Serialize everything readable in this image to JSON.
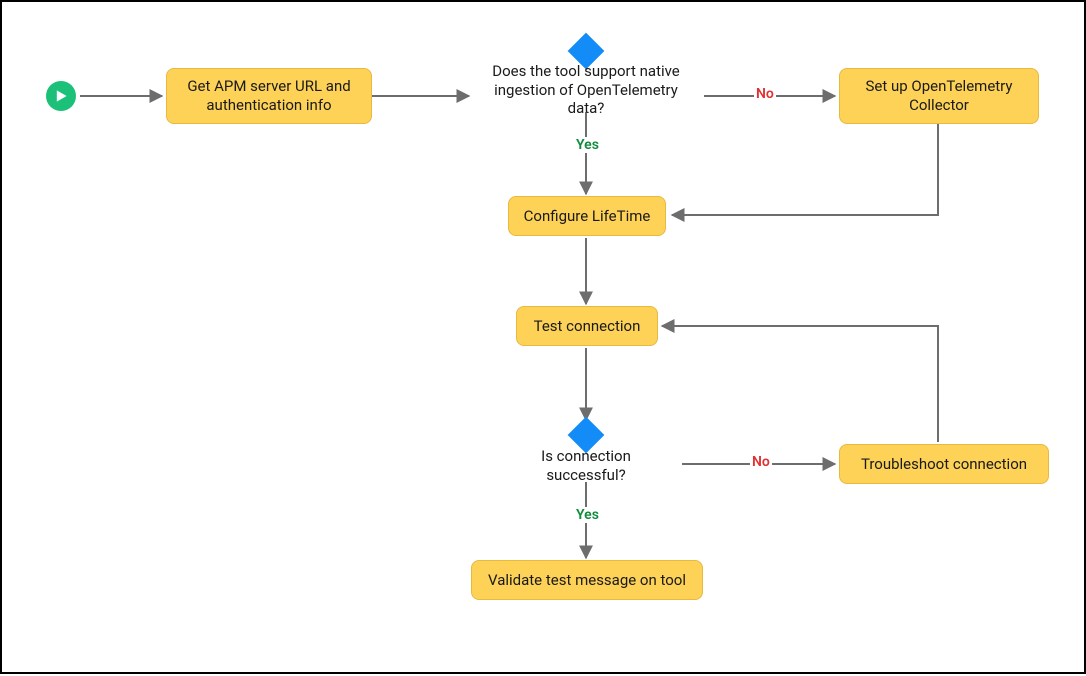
{
  "nodes": {
    "start": {
      "type": "start"
    },
    "get_apm": {
      "type": "process",
      "label": "Get APM server URL and authentication info"
    },
    "decision_native": {
      "type": "decision",
      "label": "Does the tool support native ingestion of OpenTelemetry data?"
    },
    "set_up_collector": {
      "type": "process",
      "label": "Set up OpenTelemetry Collector"
    },
    "configure_lifetime": {
      "type": "process",
      "label": "Configure LifeTime"
    },
    "test_connection": {
      "type": "process",
      "label": "Test connection"
    },
    "decision_success": {
      "type": "decision",
      "label": "Is connection successful?"
    },
    "troubleshoot": {
      "type": "process",
      "label": "Troubleshoot  connection"
    },
    "validate": {
      "type": "process",
      "label": "Validate test message on tool"
    }
  },
  "edges": [
    {
      "from": "start",
      "to": "get_apm",
      "label": null
    },
    {
      "from": "get_apm",
      "to": "decision_native",
      "label": null
    },
    {
      "from": "decision_native",
      "to": "set_up_collector",
      "label": "No"
    },
    {
      "from": "decision_native",
      "to": "configure_lifetime",
      "label": "Yes"
    },
    {
      "from": "set_up_collector",
      "to": "configure_lifetime",
      "label": null
    },
    {
      "from": "configure_lifetime",
      "to": "test_connection",
      "label": null
    },
    {
      "from": "test_connection",
      "to": "decision_success",
      "label": null
    },
    {
      "from": "decision_success",
      "to": "troubleshoot",
      "label": "No"
    },
    {
      "from": "troubleshoot",
      "to": "test_connection",
      "label": null
    },
    {
      "from": "decision_success",
      "to": "validate",
      "label": "Yes"
    }
  ],
  "labels": {
    "yes": "Yes",
    "no": "No"
  },
  "colors": {
    "process_fill": "#fdd257",
    "process_border": "#e8b93f",
    "diamond_fill": "#148cf7",
    "start_fill": "#1bc178",
    "arrow": "#6d6d6d",
    "yes": "#0f8a3c",
    "no": "#e03131"
  }
}
